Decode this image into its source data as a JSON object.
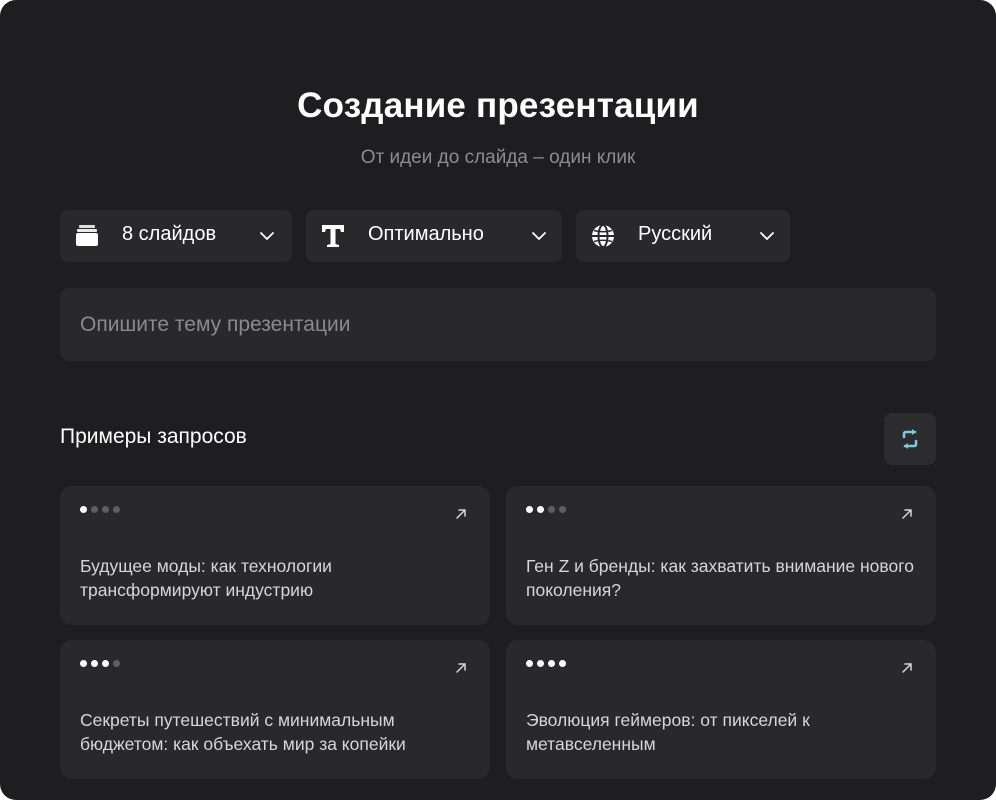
{
  "header": {
    "title": "Создание презентации",
    "subtitle": "От идеи до слайда – один клик"
  },
  "controls": {
    "slides": {
      "label": "8 слайдов",
      "icon": "slides-stack-icon"
    },
    "style": {
      "label": "Оптимально",
      "icon": "text-style-icon"
    },
    "language": {
      "label": "Русский",
      "icon": "globe-icon"
    }
  },
  "prompt": {
    "placeholder": "Опишите тему презентации",
    "value": ""
  },
  "examples": {
    "title": "Примеры запросов",
    "refresh_icon": "refresh-icon",
    "items": [
      {
        "level": 1,
        "text": "Будущее моды: как технологии трансформируют индустрию"
      },
      {
        "level": 2,
        "text": "Ген Z и бренды: как захватить внимание нового поколения?"
      },
      {
        "level": 3,
        "text": "Секреты путешествий с минимальным бюджетом: как объехать мир за копейки"
      },
      {
        "level": 4,
        "text": "Эволюция геймеров: от пикселей к метавселенным"
      }
    ]
  },
  "colors": {
    "background": "#1e1e20",
    "surface": "#29292c",
    "accent": "#7cc8dc",
    "text": "#ffffff",
    "muted": "#8c8c90"
  }
}
